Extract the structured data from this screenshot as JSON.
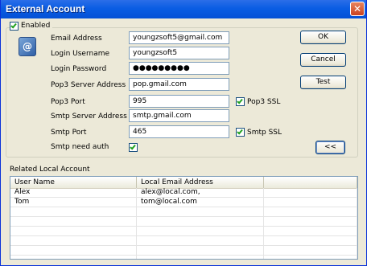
{
  "window": {
    "title": "External Account",
    "close_glyph": "✕"
  },
  "enabled": {
    "label": "Enabled",
    "checked": true
  },
  "fields": [
    {
      "label": "Email Address",
      "value": "youngzsoft5@gmail.com"
    },
    {
      "label": "Login Username",
      "value": "youngzsoft5"
    },
    {
      "label": "Login Password",
      "value": "●●●●●●●●●"
    },
    {
      "label": "Pop3 Server Address",
      "value": "pop.gmail.com"
    },
    {
      "label": "Pop3 Port",
      "value": "995"
    },
    {
      "label": "Smtp Server Address",
      "value": "smtp.gmail.com"
    },
    {
      "label": "Smtp Port",
      "value": "465"
    },
    {
      "label": "Smtp need auth"
    }
  ],
  "pop3_ssl": {
    "label": "Pop3 SSL",
    "checked": true
  },
  "smtp_ssl": {
    "label": "Smtp SSL",
    "checked": true
  },
  "smtp_auth": {
    "checked": true
  },
  "buttons": {
    "ok": "OK",
    "cancel": "Cancel",
    "test": "Test",
    "collapse": "<<"
  },
  "related": {
    "title": "Related Local Account",
    "columns": [
      "User Name",
      "Local Email Address",
      ""
    ],
    "rows": [
      [
        "Alex",
        "alex@local.com,",
        ""
      ],
      [
        "Tom",
        "tom@local.com",
        ""
      ],
      [
        "",
        "",
        ""
      ],
      [
        "",
        "",
        ""
      ],
      [
        "",
        "",
        ""
      ],
      [
        "",
        "",
        ""
      ],
      [
        "",
        "",
        ""
      ],
      [
        "",
        "",
        ""
      ]
    ]
  },
  "colors": {
    "titlebar": "#0a5de3",
    "window_bg": "#ece9d8",
    "check": "#21a121",
    "close": "#c9421f"
  },
  "icons": {
    "account": "email-account-icon",
    "close": "close-icon"
  }
}
